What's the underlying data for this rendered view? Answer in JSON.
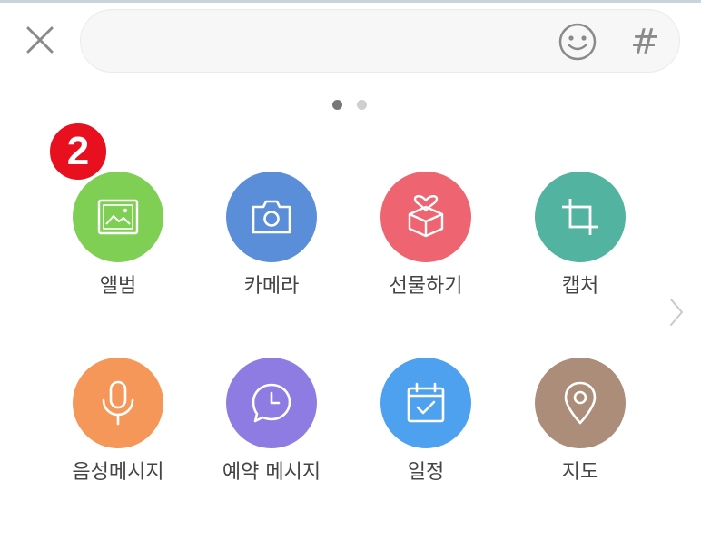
{
  "header": {
    "close_icon": "close-icon",
    "search": {
      "value": "",
      "placeholder": ""
    },
    "emoji_icon": "smiley-icon",
    "hashtag_label": "#"
  },
  "pager": {
    "current_page": 1,
    "total_pages": 2
  },
  "badge": {
    "value": "2"
  },
  "grid": {
    "items": [
      {
        "label": "앨범",
        "icon": "image-icon",
        "color": "#7fcf54"
      },
      {
        "label": "카메라",
        "icon": "camera-icon",
        "color": "#5b8ed8"
      },
      {
        "label": "선물하기",
        "icon": "gift-icon",
        "color": "#ee6571"
      },
      {
        "label": "캡처",
        "icon": "crop-icon",
        "color": "#52b3a0"
      },
      {
        "label": "음성메시지",
        "icon": "microphone-icon",
        "color": "#f59758"
      },
      {
        "label": "예약 메시지",
        "icon": "clock-bubble-icon",
        "color": "#8f7ce3"
      },
      {
        "label": "일정",
        "icon": "calendar-icon",
        "color": "#4ea1ee"
      },
      {
        "label": "지도",
        "icon": "location-pin-icon",
        "color": "#ab8d79"
      }
    ]
  },
  "navigation": {
    "next_icon": "chevron-right-icon"
  },
  "colors": {
    "icon_gray": "#8a8a8a",
    "label_text": "#444444",
    "badge_red": "#e8101e"
  }
}
